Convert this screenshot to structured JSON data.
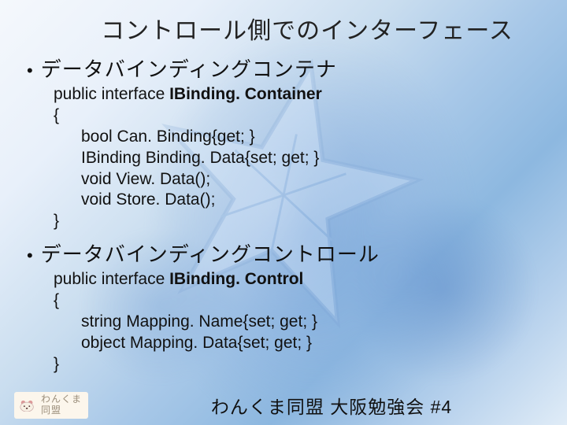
{
  "title": "コントロール側でのインターフェース",
  "bullets": [
    {
      "heading": "データバインディングコンテナ",
      "code": {
        "decl_prefix": "public interface ",
        "decl_name": "IBinding. Container",
        "lines": [
          "{",
          "      bool Can. Binding{get; }",
          "      IBinding Binding. Data{set; get; }",
          "      void View. Data();",
          "      void Store. Data();",
          "}"
        ]
      }
    },
    {
      "heading": "データバインディングコントロール",
      "code": {
        "decl_prefix": "public interface ",
        "decl_name": "IBinding. Control",
        "lines": [
          "{",
          "      string Mapping. Name{set; get; }",
          "      object Mapping. Data{set; get; }",
          "}"
        ]
      }
    }
  ],
  "footer": {
    "logo_line1": "わんくま",
    "logo_line2": "同盟",
    "event": "わんくま同盟 大阪勉強会 #4"
  }
}
